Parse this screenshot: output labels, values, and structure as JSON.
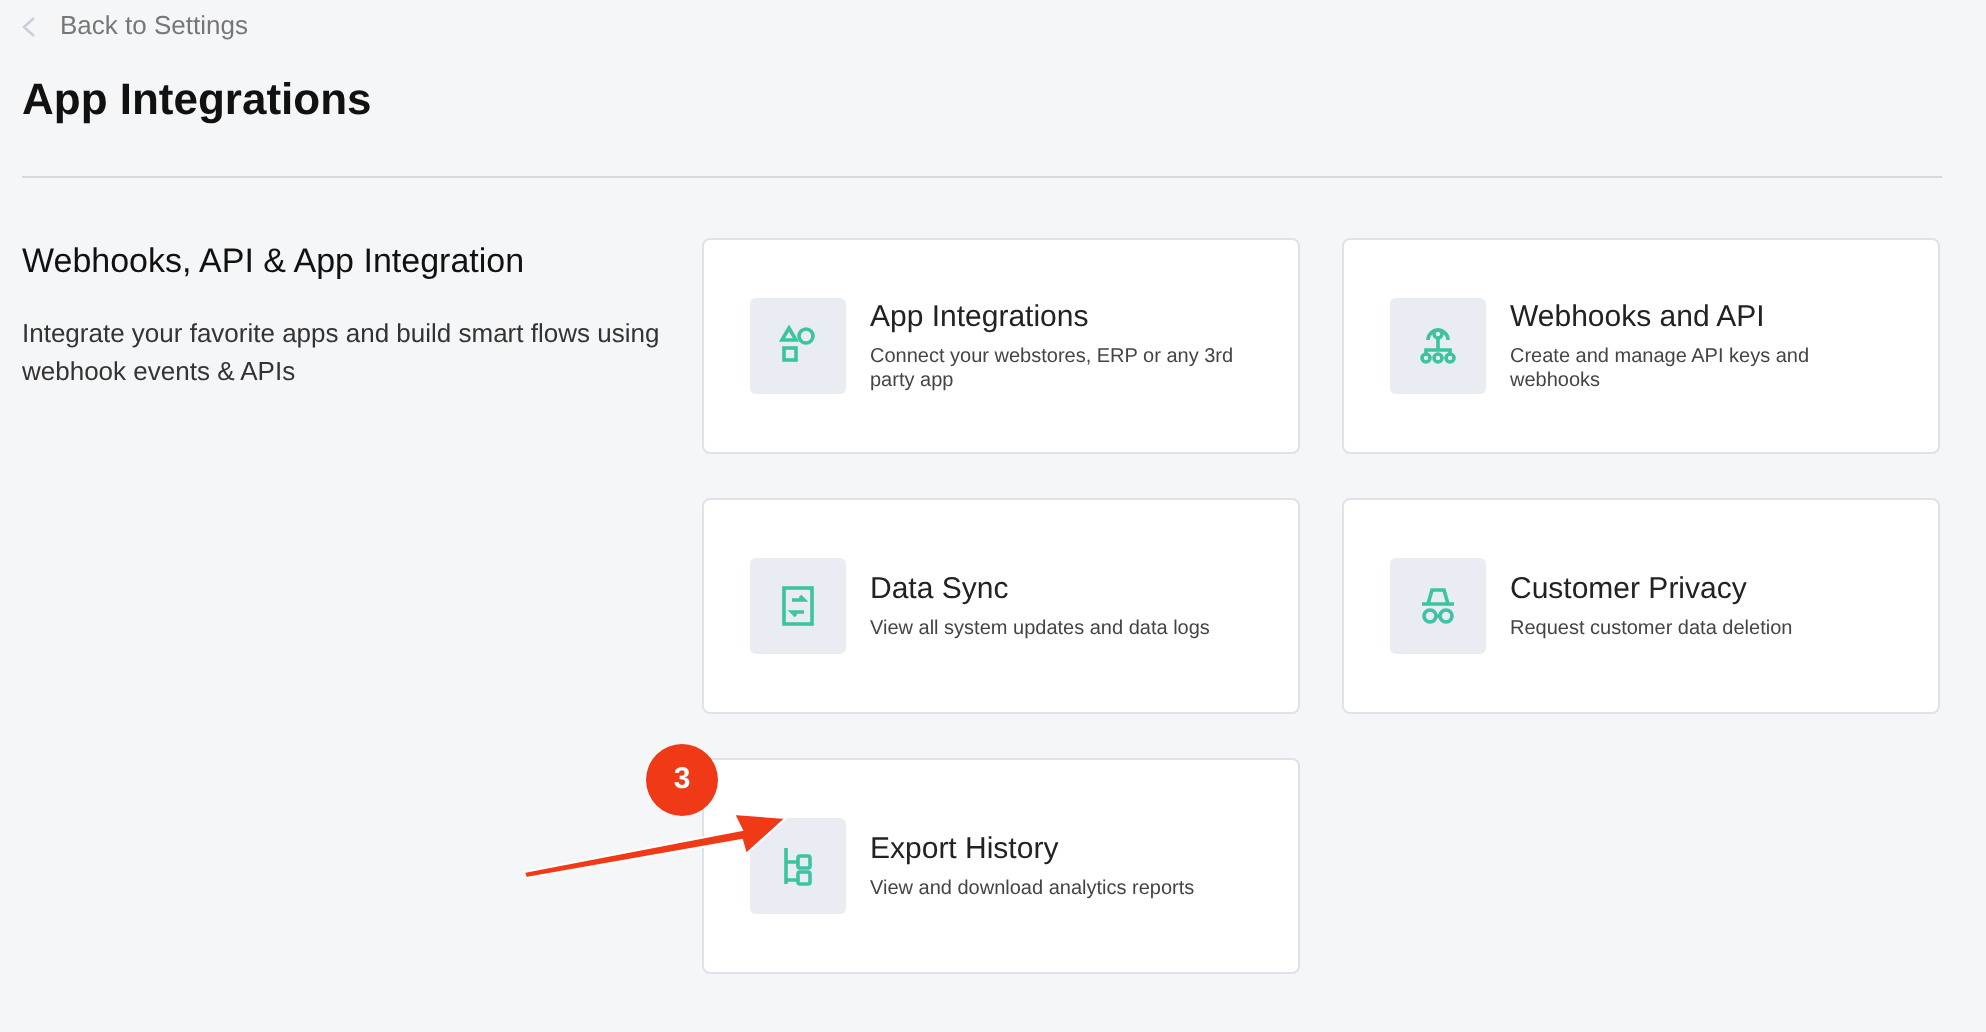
{
  "back_link": "Back to Settings",
  "page_title": "App Integrations",
  "section": {
    "title": "Webhooks, API & App Integration",
    "description": "Integrate your favorite apps and build smart flows using webhook events & APIs"
  },
  "cards": [
    {
      "kind": "shapes",
      "title": "App Integrations",
      "description": "Connect your webstores, ERP or any 3rd party app"
    },
    {
      "kind": "webhook",
      "title": "Webhooks and API",
      "description": "Create and manage API keys and webhooks"
    },
    {
      "kind": "sync",
      "title": "Data Sync",
      "description": "View all system updates and data logs"
    },
    {
      "kind": "incognito",
      "title": "Customer Privacy",
      "description": "Request customer data deletion"
    },
    {
      "kind": "tree",
      "title": "Export History",
      "description": "View and download analytics reports"
    }
  ],
  "annotation": {
    "badge": "3"
  }
}
